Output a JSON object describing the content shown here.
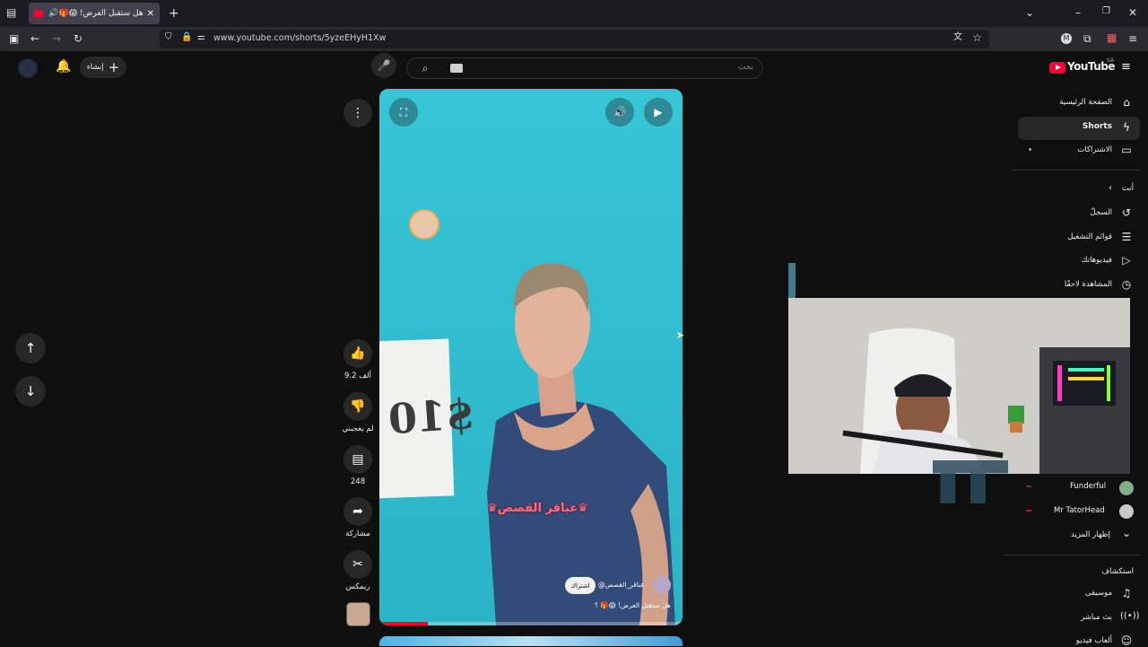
{
  "browser": {
    "tab_title": "هل ستقبل العرض! 😱🎁 ؟",
    "url": "www.youtube.com/shorts/5yzeEHyH1Xw",
    "icons": [
      "tab-list-icon",
      "sound-icon",
      "close-tab-icon",
      "new-tab-icon",
      "sidebar-icon",
      "back-icon",
      "forward-icon",
      "reload-icon",
      "shield-icon",
      "lock-icon",
      "translate-icon",
      "bookmark-star-icon",
      "profile-icon",
      "extensions-icon",
      "menu-icon"
    ]
  },
  "header": {
    "logo": "YouTube",
    "region": "SA",
    "search_placeholder": "بحث",
    "create_label": "إنشاء"
  },
  "sidebar": {
    "items": [
      {
        "label": "الصفحة الرئيسية",
        "icon": "home-icon"
      },
      {
        "label": "Shorts",
        "icon": "shorts-icon"
      },
      {
        "label": "الاشتراكات",
        "icon": "subscriptions-icon"
      }
    ],
    "you_section_title": "أنت",
    "you_items": [
      {
        "label": "السجلّ",
        "icon": "history-icon"
      },
      {
        "label": "قوائم التشغيل",
        "icon": "playlists-icon"
      },
      {
        "label": "فيديوهاتك",
        "icon": "your-videos-icon"
      },
      {
        "label": "المشاهدة لاحقًا",
        "icon": "watch-later-icon"
      }
    ],
    "subscriptions": [
      {
        "label": "Funderful"
      },
      {
        "label": "Mr TatorHead"
      }
    ],
    "show_more": "إظهار المزيد",
    "explore_title": "استكشاف",
    "explore_items": [
      {
        "label": "موسيقى",
        "icon": "music-icon"
      },
      {
        "label": "بث مباشر",
        "icon": "live-icon"
      },
      {
        "label": "ألعاب فيديو",
        "icon": "gaming-icon"
      }
    ]
  },
  "video": {
    "overlay_text": "♛عباقر القصص♛",
    "sign_text": "$10",
    "channel": "@عباقر_القصص",
    "subscribe_label": "اشتراك",
    "title": "هل ستقبل العرض! 😱🎁 ؟",
    "progress": 0.16
  },
  "actions": {
    "like_count": "9.2 ألف",
    "dislike_label": "لم يعجبني",
    "comments_count": "248",
    "share_label": "مشاركة",
    "remix_label": "ريمكس"
  },
  "colors": {
    "accent": "#ff0033",
    "video_bg": "#35c2d3",
    "page_bg": "#0f0f0f"
  }
}
